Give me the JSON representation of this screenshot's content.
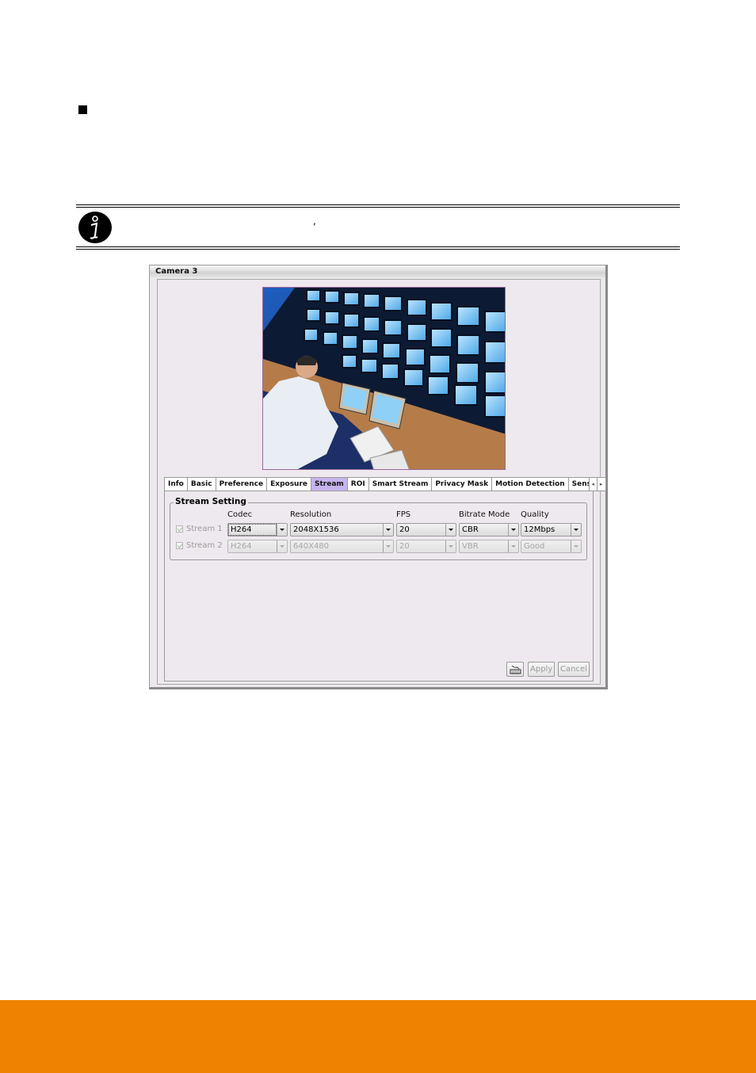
{
  "page": {
    "note_text": ",",
    "footer_color": "#ef8200"
  },
  "window": {
    "title": "Camera 3",
    "preview_alt": "Surveillance control room with operator and monitor wall",
    "tabs": [
      {
        "label": "Info",
        "active": false
      },
      {
        "label": "Basic",
        "active": false
      },
      {
        "label": "Preference",
        "active": false
      },
      {
        "label": "Exposure",
        "active": false
      },
      {
        "label": "Stream",
        "active": true
      },
      {
        "label": "ROI",
        "active": false
      },
      {
        "label": "Smart Stream",
        "active": false
      },
      {
        "label": "Privacy Mask",
        "active": false
      },
      {
        "label": "Motion Detection",
        "active": false
      },
      {
        "label": "Sens",
        "active": false
      }
    ],
    "tab_scroll": {
      "left_icon": "◂",
      "right_icon": "▸"
    },
    "stream_setting": {
      "legend": "Stream Setting",
      "columns": [
        "Codec",
        "Resolution",
        "FPS",
        "Bitrate Mode",
        "Quality"
      ],
      "rows": [
        {
          "label": "Stream 1",
          "checked": true,
          "enabled": true,
          "codec": "H264",
          "resolution": "2048X1536",
          "fps": "20",
          "bitrate_mode": "CBR",
          "quality": "12Mbps"
        },
        {
          "label": "Stream 2",
          "checked": true,
          "enabled": false,
          "codec": "H264",
          "resolution": "640X480",
          "fps": "20",
          "bitrate_mode": "VBR",
          "quality": "Good"
        }
      ]
    },
    "buttons": {
      "keyboard_icon": "keyboard-icon",
      "apply": "Apply",
      "cancel": "Cancel"
    }
  }
}
